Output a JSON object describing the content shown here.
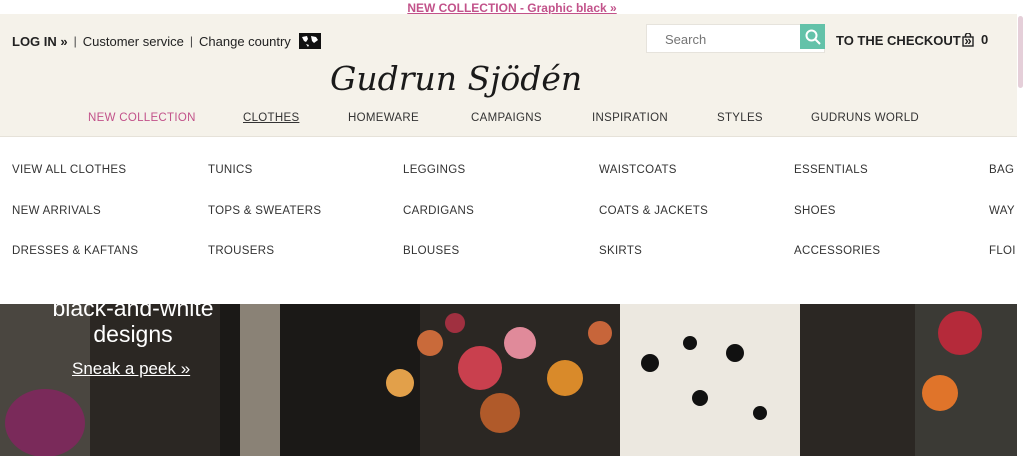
{
  "announcement": "NEW COLLECTION - Graphic black »",
  "header": {
    "login": "LOG IN »",
    "customer_service": "Customer service",
    "change_country": "Change country",
    "search_placeholder": "Search",
    "checkout": "TO THE CHECKOUT »",
    "cart_count": "0",
    "logo_text": "Gudrun Sjödén"
  },
  "nav": [
    "NEW COLLECTION",
    "CLOTHES",
    "HOMEWARE",
    "CAMPAIGNS",
    "INSPIRATION",
    "STYLES",
    "GUDRUNS WORLD"
  ],
  "menu": {
    "col1": [
      "VIEW ALL CLOTHES",
      "NEW ARRIVALS",
      "DRESSES & KAFTANS"
    ],
    "col2": [
      "TUNICS",
      "TOPS & SWEATERS",
      "TROUSERS"
    ],
    "col3": [
      "LEGGINGS",
      "CARDIGANS",
      "BLOUSES"
    ],
    "col4": [
      "WAISTCOATS",
      "COATS & JACKETS",
      "SKIRTS"
    ],
    "col5": [
      "ESSENTIALS",
      "SHOES",
      "ACCESSORIES"
    ],
    "col6": [
      "BAG",
      "WAY",
      "FLOI"
    ]
  },
  "hero": {
    "headline_line1": "black-and-white",
    "headline_line2": "designs",
    "cta": "Sneak a peek »"
  },
  "colors": {
    "accent_pink": "#c2528a",
    "search_green": "#63c2a9",
    "header_bg": "#f5f2ea"
  }
}
